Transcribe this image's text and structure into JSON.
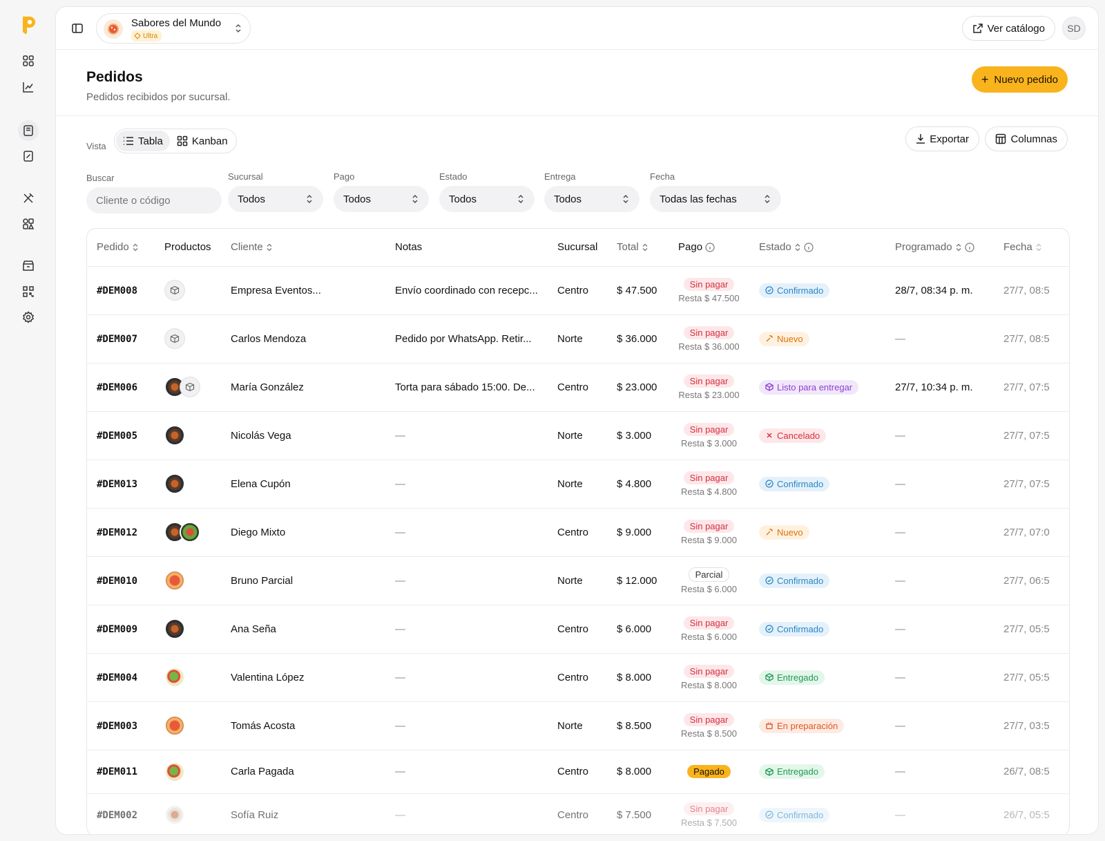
{
  "store": {
    "name": "Sabores del Mundo",
    "plan": "Ultra"
  },
  "topbar": {
    "catalog_label": "Ver catálogo",
    "user_initials": "SD"
  },
  "header": {
    "title": "Pedidos",
    "subtitle": "Pedidos recibidos por sucursal.",
    "new_order_label": "Nuevo pedido"
  },
  "view": {
    "label": "Vista",
    "table_label": "Tabla",
    "kanban_label": "Kanban",
    "export_label": "Exportar",
    "columns_label": "Columnas"
  },
  "filters": {
    "search_label": "Buscar",
    "search_placeholder": "Cliente o código",
    "branch_label": "Sucursal",
    "branch_value": "Todos",
    "payment_label": "Pago",
    "payment_value": "Todos",
    "status_label": "Estado",
    "status_value": "Todos",
    "delivery_label": "Entrega",
    "delivery_value": "Todos",
    "date_label": "Fecha",
    "date_value": "Todas las fechas"
  },
  "table": {
    "headers": {
      "order": "Pedido",
      "products": "Productos",
      "client": "Cliente",
      "notes": "Notas",
      "branch": "Sucursal",
      "total": "Total",
      "payment": "Pago",
      "status": "Estado",
      "scheduled": "Programado",
      "date": "Fecha"
    },
    "rows": [
      {
        "code": "#DEM008",
        "products": [
          "box"
        ],
        "client": "Empresa Eventos...",
        "notes": "Envío coordinado con recepc...",
        "branch": "Centro",
        "total": "$ 47.500",
        "pay_status": "Sin pagar",
        "pay_kind": "unpaid",
        "rest": "Resta $ 47.500",
        "status": "Confirmado",
        "status_kind": "confirmado",
        "scheduled": "28/7, 08:34 p. m.",
        "date": "27/7, 08:5"
      },
      {
        "code": "#DEM007",
        "products": [
          "box"
        ],
        "client": "Carlos Mendoza",
        "notes": "Pedido por WhatsApp. Retir...",
        "branch": "Norte",
        "total": "$ 36.000",
        "pay_status": "Sin pagar",
        "pay_kind": "unpaid",
        "rest": "Resta $ 36.000",
        "status": "Nuevo",
        "status_kind": "nuevo",
        "scheduled": "—",
        "date": "27/7, 08:5"
      },
      {
        "code": "#DEM006",
        "products": [
          "bowl",
          "box"
        ],
        "client": "María González",
        "notes": "Torta para sábado 15:00. De...",
        "branch": "Centro",
        "total": "$ 23.000",
        "pay_status": "Sin pagar",
        "pay_kind": "unpaid",
        "rest": "Resta $ 23.000",
        "status": "Listo para entregar",
        "status_kind": "listo",
        "scheduled": "27/7, 10:34 p. m.",
        "date": "27/7, 07:5"
      },
      {
        "code": "#DEM005",
        "products": [
          "bowl"
        ],
        "client": "Nicolás Vega",
        "notes": "—",
        "branch": "Norte",
        "total": "$ 3.000",
        "pay_status": "Sin pagar",
        "pay_kind": "unpaid",
        "rest": "Resta $ 3.000",
        "status": "Cancelado",
        "status_kind": "cancelado",
        "scheduled": "—",
        "date": "27/7, 07:5"
      },
      {
        "code": "#DEM013",
        "products": [
          "bowl"
        ],
        "client": "Elena Cupón",
        "notes": "—",
        "branch": "Norte",
        "total": "$ 4.800",
        "pay_status": "Sin pagar",
        "pay_kind": "unpaid",
        "rest": "Resta $ 4.800",
        "status": "Confirmado",
        "status_kind": "confirmado",
        "scheduled": "—",
        "date": "27/7, 07:5"
      },
      {
        "code": "#DEM012",
        "products": [
          "bowl",
          "mix"
        ],
        "client": "Diego Mixto",
        "notes": "—",
        "branch": "Centro",
        "total": "$ 9.000",
        "pay_status": "Sin pagar",
        "pay_kind": "unpaid",
        "rest": "Resta $ 9.000",
        "status": "Nuevo",
        "status_kind": "nuevo",
        "scheduled": "—",
        "date": "27/7, 07:0"
      },
      {
        "code": "#DEM010",
        "products": [
          "pizza"
        ],
        "client": "Bruno Parcial",
        "notes": "—",
        "branch": "Norte",
        "total": "$ 12.000",
        "pay_status": "Parcial",
        "pay_kind": "partial",
        "rest": "Resta $ 6.000",
        "status": "Confirmado",
        "status_kind": "confirmado",
        "scheduled": "—",
        "date": "27/7, 06:5"
      },
      {
        "code": "#DEM009",
        "products": [
          "bowl"
        ],
        "client": "Ana Seña",
        "notes": "—",
        "branch": "Centro",
        "total": "$ 6.000",
        "pay_status": "Sin pagar",
        "pay_kind": "unpaid",
        "rest": "Resta $ 6.000",
        "status": "Confirmado",
        "status_kind": "confirmado",
        "scheduled": "—",
        "date": "27/7, 05:5"
      },
      {
        "code": "#DEM004",
        "products": [
          "salad"
        ],
        "client": "Valentina López",
        "notes": "—",
        "branch": "Centro",
        "total": "$ 8.000",
        "pay_status": "Sin pagar",
        "pay_kind": "unpaid",
        "rest": "Resta $ 8.000",
        "status": "Entregado",
        "status_kind": "entregado",
        "scheduled": "—",
        "date": "27/7, 05:5"
      },
      {
        "code": "#DEM003",
        "products": [
          "pizza"
        ],
        "client": "Tomás Acosta",
        "notes": "—",
        "branch": "Norte",
        "total": "$ 8.500",
        "pay_status": "Sin pagar",
        "pay_kind": "unpaid",
        "rest": "Resta $ 8.500",
        "status": "En preparación",
        "status_kind": "preparacion",
        "scheduled": "—",
        "date": "27/7, 03:5"
      },
      {
        "code": "#DEM011",
        "products": [
          "salad"
        ],
        "client": "Carla Pagada",
        "notes": "—",
        "branch": "Centro",
        "total": "$ 8.000",
        "pay_status": "Pagado",
        "pay_kind": "paid",
        "rest": "",
        "status": "Entregado",
        "status_kind": "entregado",
        "scheduled": "—",
        "date": "26/7, 08:5"
      },
      {
        "code": "#DEM002",
        "products": [
          "plate"
        ],
        "client": "Sofía Ruiz",
        "notes": "—",
        "branch": "Centro",
        "total": "$ 7.500",
        "pay_status": "Sin pagar",
        "pay_kind": "unpaid",
        "rest": "Resta $ 7.500",
        "status": "Confirmado",
        "status_kind": "confirmado",
        "scheduled": "—",
        "date": "26/7, 05:5"
      }
    ]
  },
  "icons": {
    "sidebar": [
      "dashboard-icon",
      "analytics-icon",
      "orders-icon",
      "receipt-icon",
      "utensils-icon",
      "products-icon",
      "store-icon",
      "qr-icon",
      "settings-icon"
    ],
    "status": {
      "confirmado": "check-circle-icon",
      "nuevo": "sparkle-icon",
      "listo": "package-icon",
      "cancelado": "x-icon",
      "entregado": "package-check-icon",
      "preparacion": "cooking-pot-icon"
    }
  },
  "colors": {
    "accent": "#f9b31c",
    "unpaid": "#d3303e",
    "confirmed": "#2b86c5",
    "new": "#d9730d",
    "ready": "#8f3fd1",
    "delivered": "#1f9a54",
    "preparing": "#e0551f"
  }
}
